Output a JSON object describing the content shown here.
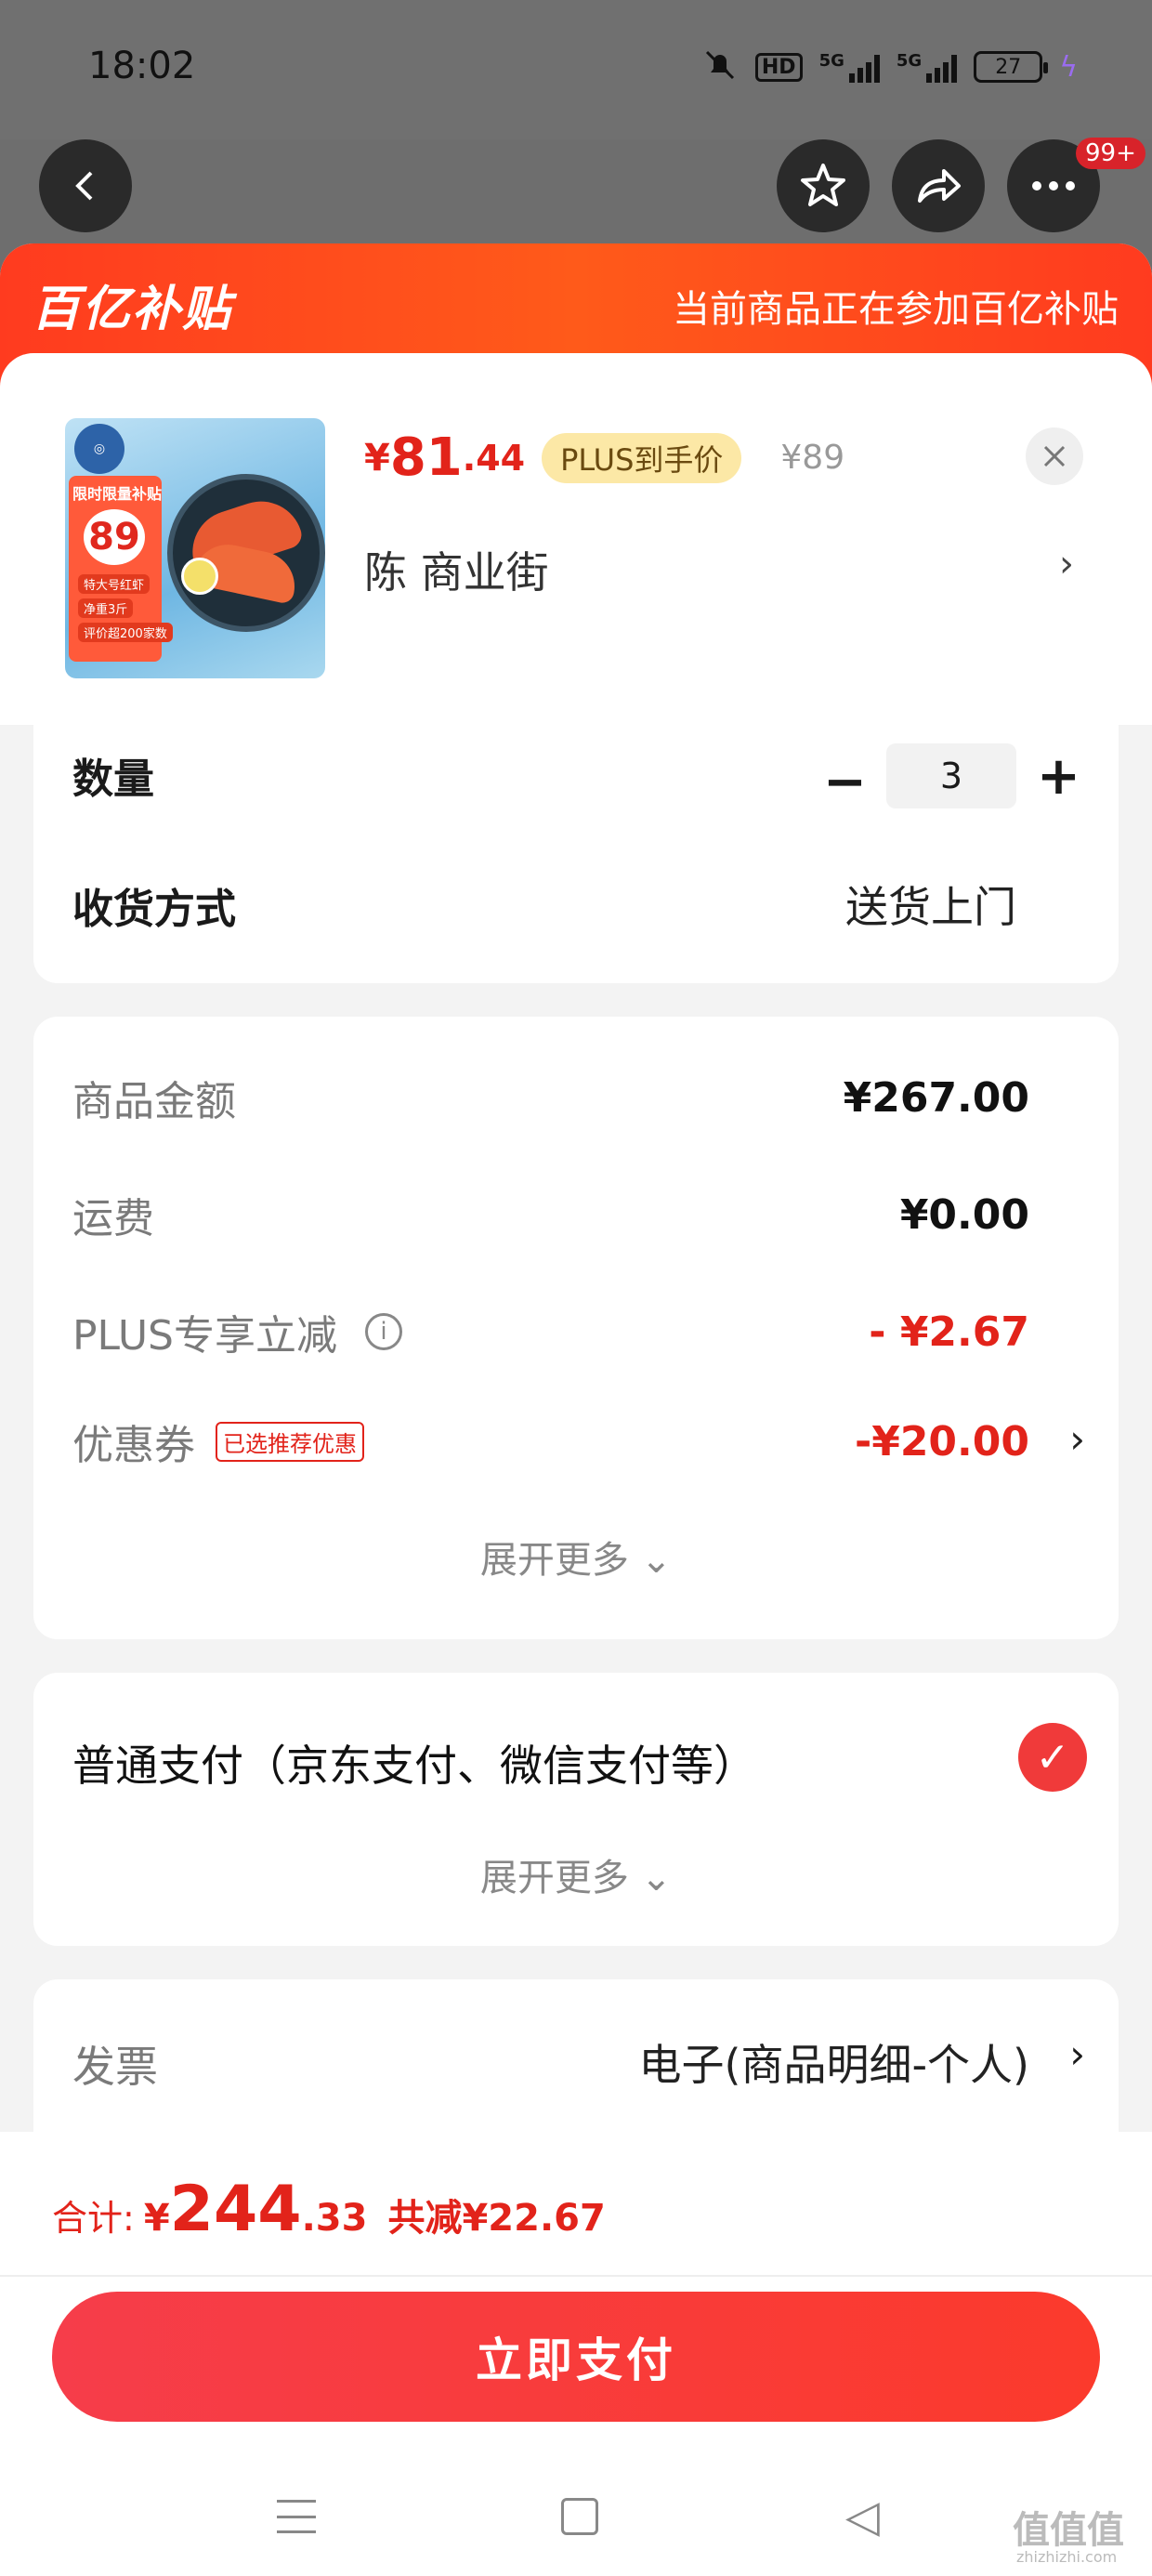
{
  "status_bar": {
    "time": "18:02",
    "hd": "HD",
    "signal1": "5G",
    "signal2": "5G",
    "battery": "27"
  },
  "nav": {
    "badge": "99+"
  },
  "banner": {
    "logo": "百亿补贴",
    "text": "当前商品正在参加百亿补贴"
  },
  "product": {
    "price_currency": "¥",
    "price_int": "81",
    "price_dec": ".44",
    "plus_tag": "PLUS到手价",
    "orig_price": "¥89",
    "address": "陈  商业街",
    "thumb_tag": "限时限量补贴",
    "thumb_num": "89",
    "thumb_line1": "特大号红虾",
    "thumb_line2": "净重3斤",
    "thumb_line3": "评价超200家数"
  },
  "quantity": {
    "label": "数量",
    "value": "3",
    "minus": "−",
    "plus": "+"
  },
  "delivery": {
    "label": "收货方式",
    "value": "送货上门"
  },
  "fees": {
    "goods_label": "商品金额",
    "goods_value": "¥267.00",
    "shipping_label": "运费",
    "shipping_value": "¥0.00",
    "plus_label": "PLUS专享立减",
    "plus_value": "- ¥2.67",
    "coupon_label": "优惠券",
    "coupon_tag": "已选推荐优惠",
    "coupon_value": "-¥20.00",
    "expand": "展开更多 ⌄"
  },
  "payment": {
    "label": "普通支付（京东支付、微信支付等）",
    "expand": "展开更多 ⌄"
  },
  "invoice": {
    "label": "发票",
    "value": "电子(商品明细-个人)"
  },
  "total": {
    "label": "合计:",
    "currency": "¥",
    "int": "244",
    "dec": ".33",
    "save": "共减¥22.67"
  },
  "pay_button": "立即支付",
  "watermark": "值值值",
  "watermark_sub": "zhizhizhi.com"
}
